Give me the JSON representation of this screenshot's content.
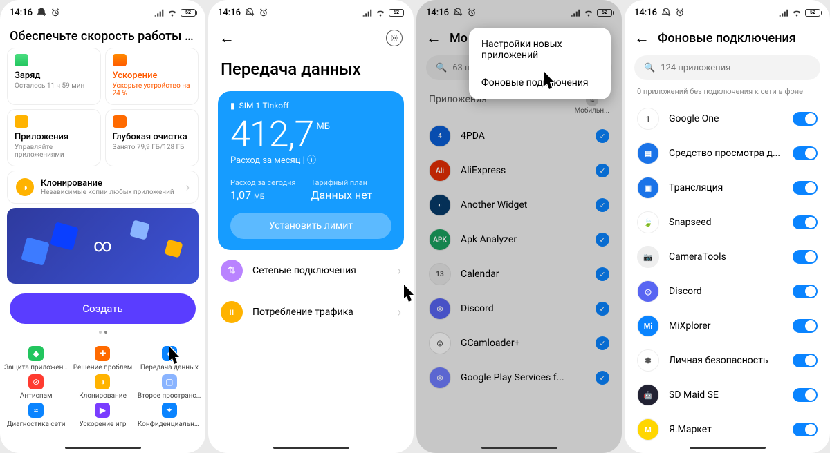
{
  "status": {
    "time": "14:16",
    "battery": "52"
  },
  "s1": {
    "title": "Обеспечьте скорость работы и безо...",
    "cards": [
      {
        "label": "Заряд",
        "sub": "Осталось 11 ч 59 мин"
      },
      {
        "label": "Ускорение",
        "sub": "Ускорьте устройство на 24 %"
      },
      {
        "label": "Приложения",
        "sub": "Управляйте приложениями"
      },
      {
        "label": "Глубокая очистка",
        "sub": "Занято 79,9 ГБ/128 ГБ"
      }
    ],
    "clone": {
      "title": "Клонирование",
      "sub": "Независимые копии любых приложений"
    },
    "create": "Создать",
    "grid": [
      {
        "label": "Защита приложени...",
        "color": "#22c55e",
        "g": "◆"
      },
      {
        "label": "Решение проблем",
        "color": "#ff6a00",
        "g": "✚"
      },
      {
        "label": "Передача данных",
        "color": "#0a84ff",
        "g": "●"
      },
      {
        "label": "Антиспам",
        "color": "#ff3b30",
        "g": "⊘"
      },
      {
        "label": "Клонирование",
        "color": "#ffb300",
        "g": "◑"
      },
      {
        "label": "Второе пространст...",
        "color": "#8ab4ff",
        "g": "▢"
      },
      {
        "label": "Диагностика сети",
        "color": "#0a84ff",
        "g": "≈"
      },
      {
        "label": "Ускорение игр",
        "color": "#7a3dff",
        "g": "▶"
      },
      {
        "label": "Конфиденциально...",
        "color": "#0a84ff",
        "g": "✦"
      }
    ]
  },
  "s2": {
    "title": "Передача данных",
    "sim": "SIM 1-Tinkoff",
    "usage_value": "412,7",
    "usage_unit": "МБ",
    "period": "Расход за месяц | ⓘ",
    "today_label": "Расход за сегодня",
    "today_value": "1,07",
    "today_unit": "МБ",
    "plan_label": "Тарифный план",
    "plan_value": "Данных нет",
    "limit_btn": "Установить лимит",
    "opts": [
      {
        "label": "Сетевые подключения",
        "color": "#b983ff",
        "g": "⇅"
      },
      {
        "label": "Потребление трафика",
        "color": "#ffb300",
        "g": "ıı"
      }
    ]
  },
  "s3": {
    "title": "Мо",
    "search": "63 пр",
    "section": "Приложения",
    "col2": "Мобильн...",
    "popup": [
      "Настройки новых приложений",
      "Фоновые подключения"
    ],
    "apps": [
      {
        "name": "4PDA",
        "color": "#0a5fd6",
        "g": "4"
      },
      {
        "name": "AliExpress",
        "color": "#e62e04",
        "g": "Ali"
      },
      {
        "name": "Another Widget",
        "color": "#073b6b",
        "g": "◐"
      },
      {
        "name": "Apk Analyzer",
        "color": "#1aa260",
        "g": "APK"
      },
      {
        "name": "Calendar",
        "color": "#e8e8e8",
        "g": "13"
      },
      {
        "name": "Discord",
        "color": "#5865f2",
        "g": "◎"
      },
      {
        "name": "GCamloader+",
        "color": "#ffffff",
        "g": "◎"
      },
      {
        "name": "Google Play Services f...",
        "color": "#6f7dff",
        "g": "◎"
      }
    ]
  },
  "s4": {
    "title": "Фоновые подключения",
    "search": "124 приложения",
    "sub": "0 приложений без подключения к сети в фоне",
    "apps": [
      {
        "name": "Google One",
        "color": "#ffffff",
        "g": "1"
      },
      {
        "name": "Средство просмотра д...",
        "color": "#1a73e8",
        "g": "▤"
      },
      {
        "name": "Трансляция",
        "color": "#1a73e8",
        "g": "▣"
      },
      {
        "name": "Snapseed",
        "color": "#ffffff",
        "g": "🍃"
      },
      {
        "name": "CameraTools",
        "color": "#eeeeee",
        "g": "📷"
      },
      {
        "name": "Discord",
        "color": "#5865f2",
        "g": "◎"
      },
      {
        "name": "MiXplorer",
        "color": "#0a84ff",
        "g": "Mi"
      },
      {
        "name": "Личная безопасность",
        "color": "#ffffff",
        "g": "✱"
      },
      {
        "name": "SD Maid SE",
        "color": "#223",
        "g": "🤖"
      },
      {
        "name": "Я.Маркет",
        "color": "#ffd600",
        "g": "М"
      }
    ]
  }
}
